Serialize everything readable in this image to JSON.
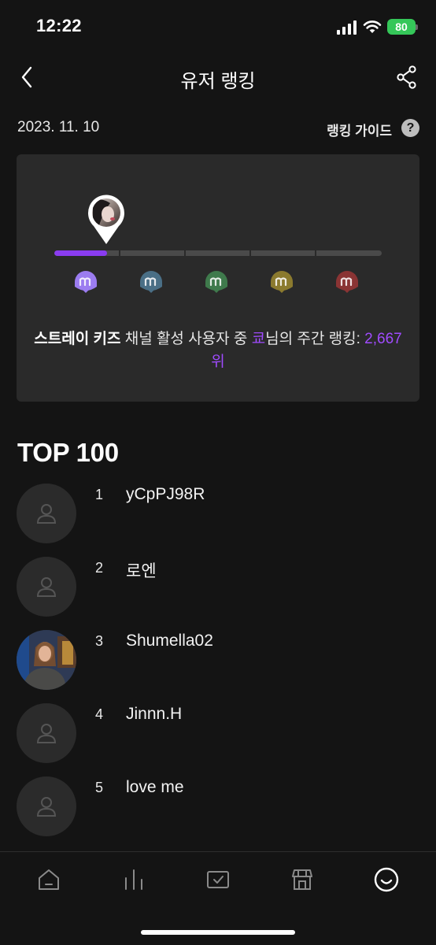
{
  "status_bar": {
    "time": "12:22",
    "battery": "80"
  },
  "header": {
    "title": "유저 랭킹"
  },
  "date": "2023. 11. 10",
  "guide": {
    "label": "랭킹 가이드",
    "help": "?"
  },
  "rank_card": {
    "progress": 0.16,
    "tier_colors": [
      "#9b7cf0",
      "#4a6f86",
      "#3f7a4c",
      "#8b7a2e",
      "#8a3434"
    ],
    "channel": "스트레이 키즈",
    "part1": " 채널 활성 사용자 중 ",
    "user": "쿄",
    "part2": "님의 주간 랭킹: ",
    "rank": "2,667위"
  },
  "top_heading": "TOP 100",
  "ranking": [
    {
      "rank": "1",
      "name": "yCpPJ98R",
      "has_photo": false
    },
    {
      "rank": "2",
      "name": "로엔",
      "has_photo": false
    },
    {
      "rank": "3",
      "name": "Shumella02",
      "has_photo": true
    },
    {
      "rank": "4",
      "name": "Jinnn.H",
      "has_photo": false
    },
    {
      "rank": "5",
      "name": "love me",
      "has_photo": false
    }
  ],
  "tabbar": {
    "items": [
      "home-icon",
      "chart-icon",
      "check-icon",
      "store-icon",
      "smile-icon"
    ]
  }
}
